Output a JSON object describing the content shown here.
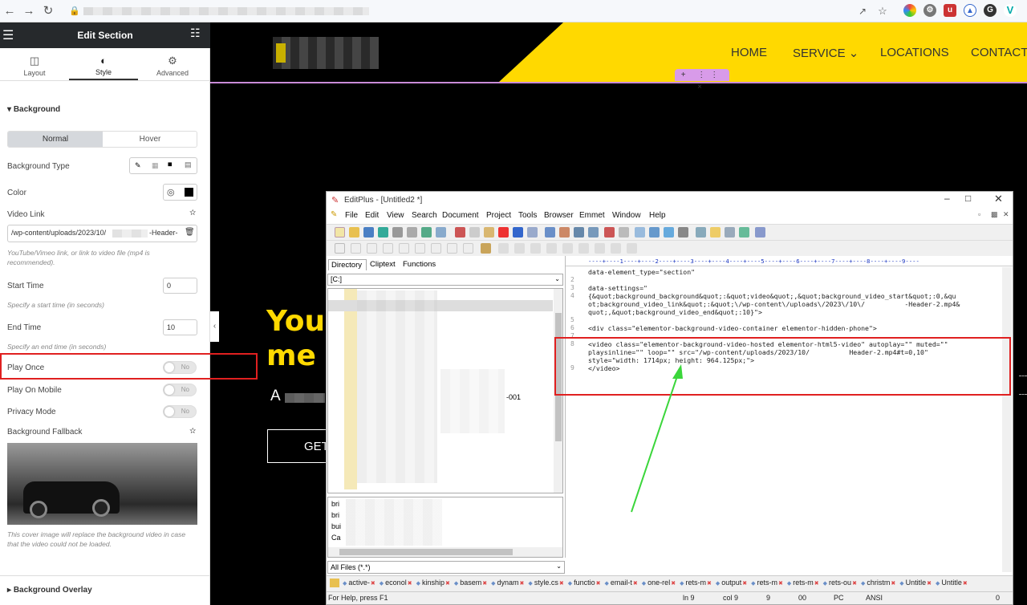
{
  "browser": {
    "icons": [
      "back-icon",
      "forward-icon",
      "reload-icon",
      "lock-icon"
    ]
  },
  "panel": {
    "title": "Edit Section",
    "tabs": [
      {
        "label": "Layout"
      },
      {
        "label": "Style"
      },
      {
        "label": "Advanced"
      }
    ],
    "section_background": "Background",
    "state_tabs": {
      "normal": "Normal",
      "hover": "Hover"
    },
    "background_type_label": "Background Type",
    "color_label": "Color",
    "video_link_label": "Video Link",
    "video_link_value": "/wp-content/uploads/2023/10/",
    "video_link_suffix": "-Header-",
    "video_link_hint": "YouTube/Vimeo link, or link to video file (mp4 is recommended).",
    "start_time_label": "Start Time",
    "start_time_value": "0",
    "start_time_hint": "Specify a start time (in seconds)",
    "end_time_label": "End Time",
    "end_time_value": "10",
    "end_time_hint": "Specify an end time (in seconds)",
    "play_once_label": "Play Once",
    "play_on_mobile_label": "Play On Mobile",
    "privacy_mode_label": "Privacy Mode",
    "toggle_off_text": "No",
    "fallback_label": "Background Fallback",
    "fallback_hint": "This cover image will replace the background video in case that the video could not be loaded.",
    "overlay_label": "Background Overlay"
  },
  "site": {
    "menu": [
      "HOME",
      "SERVICE ⌄",
      "LOCATIONS",
      "CONTACT"
    ],
    "hero_line1": "You",
    "hero_line2": "me",
    "hero_sub": "A",
    "cta": "GET"
  },
  "editplus": {
    "title": "EditPlus - [Untitled2 *]",
    "menu": [
      "File",
      "Edit",
      "View",
      "Search",
      "Document",
      "Project",
      "Tools",
      "Browser",
      "Emmet",
      "Window",
      "Help"
    ],
    "left_tabs": [
      "Directory",
      "Cliptext",
      "Functions"
    ],
    "drive": "[C:]",
    "file_suffix": "-001",
    "file_list": [
      "bri",
      "bri",
      "bui",
      "Ca"
    ],
    "filter": "All Files (*.*)",
    "ruler": "----+----1----+----2----+----3----+----4----+----5----+----6----+----7----+----8----+----9----",
    "lines": [
      {
        "n": "",
        "t": "data-element_type=\"section\""
      },
      {
        "n": "2",
        "t": ""
      },
      {
        "n": "3",
        "t": "data-settings=\""
      },
      {
        "n": "4",
        "t": "{&quot;background_background&quot;:&quot;video&quot;,&quot;background_video_start&quot;:0,&qu"
      },
      {
        "n": "",
        "t": "ot;background_video_link&quot;:&quot;\\/wp-content\\/uploads\\/2023\\/10\\/          -Header-2.mp4&"
      },
      {
        "n": "",
        "t": "quot;,&quot;background_video_end&quot;:10}\">"
      },
      {
        "n": "5",
        "t": ""
      },
      {
        "n": "6",
        "t": "<div class=\"elementor-background-video-container elementor-hidden-phone\">"
      },
      {
        "n": "7",
        "t": ""
      },
      {
        "n": "8",
        "t": "<video class=\"elementor-background-video-hosted elementor-html5-video\" autoplay=\"\" muted=\"\""
      },
      {
        "n": "",
        "t": "playsinline=\"\" loop=\"\" src=\"/wp-content/uploads/2023/10/          Header-2.mp4#t=0,10\""
      },
      {
        "n": "",
        "t": "style=\"width: 1714px; height: 964.125px;\">"
      },
      {
        "n": "9",
        "t": "</video>"
      }
    ],
    "doc_tabs": [
      "active-",
      "econol",
      "kinship",
      "basem",
      "dynam",
      "style.cs",
      "functio",
      "email-t",
      "one-rel",
      "rets-m",
      "output",
      "rets-m",
      "rets-m",
      "rets-ou",
      "christm",
      "Untitle",
      "Untitle"
    ],
    "status": {
      "help": "For Help, press F1",
      "ln": "ln 9",
      "col": "col 9",
      "n1": "9",
      "n2": "00",
      "mode": "PC",
      "enc": "ANSI",
      "n3": "0"
    }
  },
  "colors": {
    "yellow": "#ffd900",
    "annotation_red": "#e02020",
    "arrow_green": "#3bd63b"
  }
}
